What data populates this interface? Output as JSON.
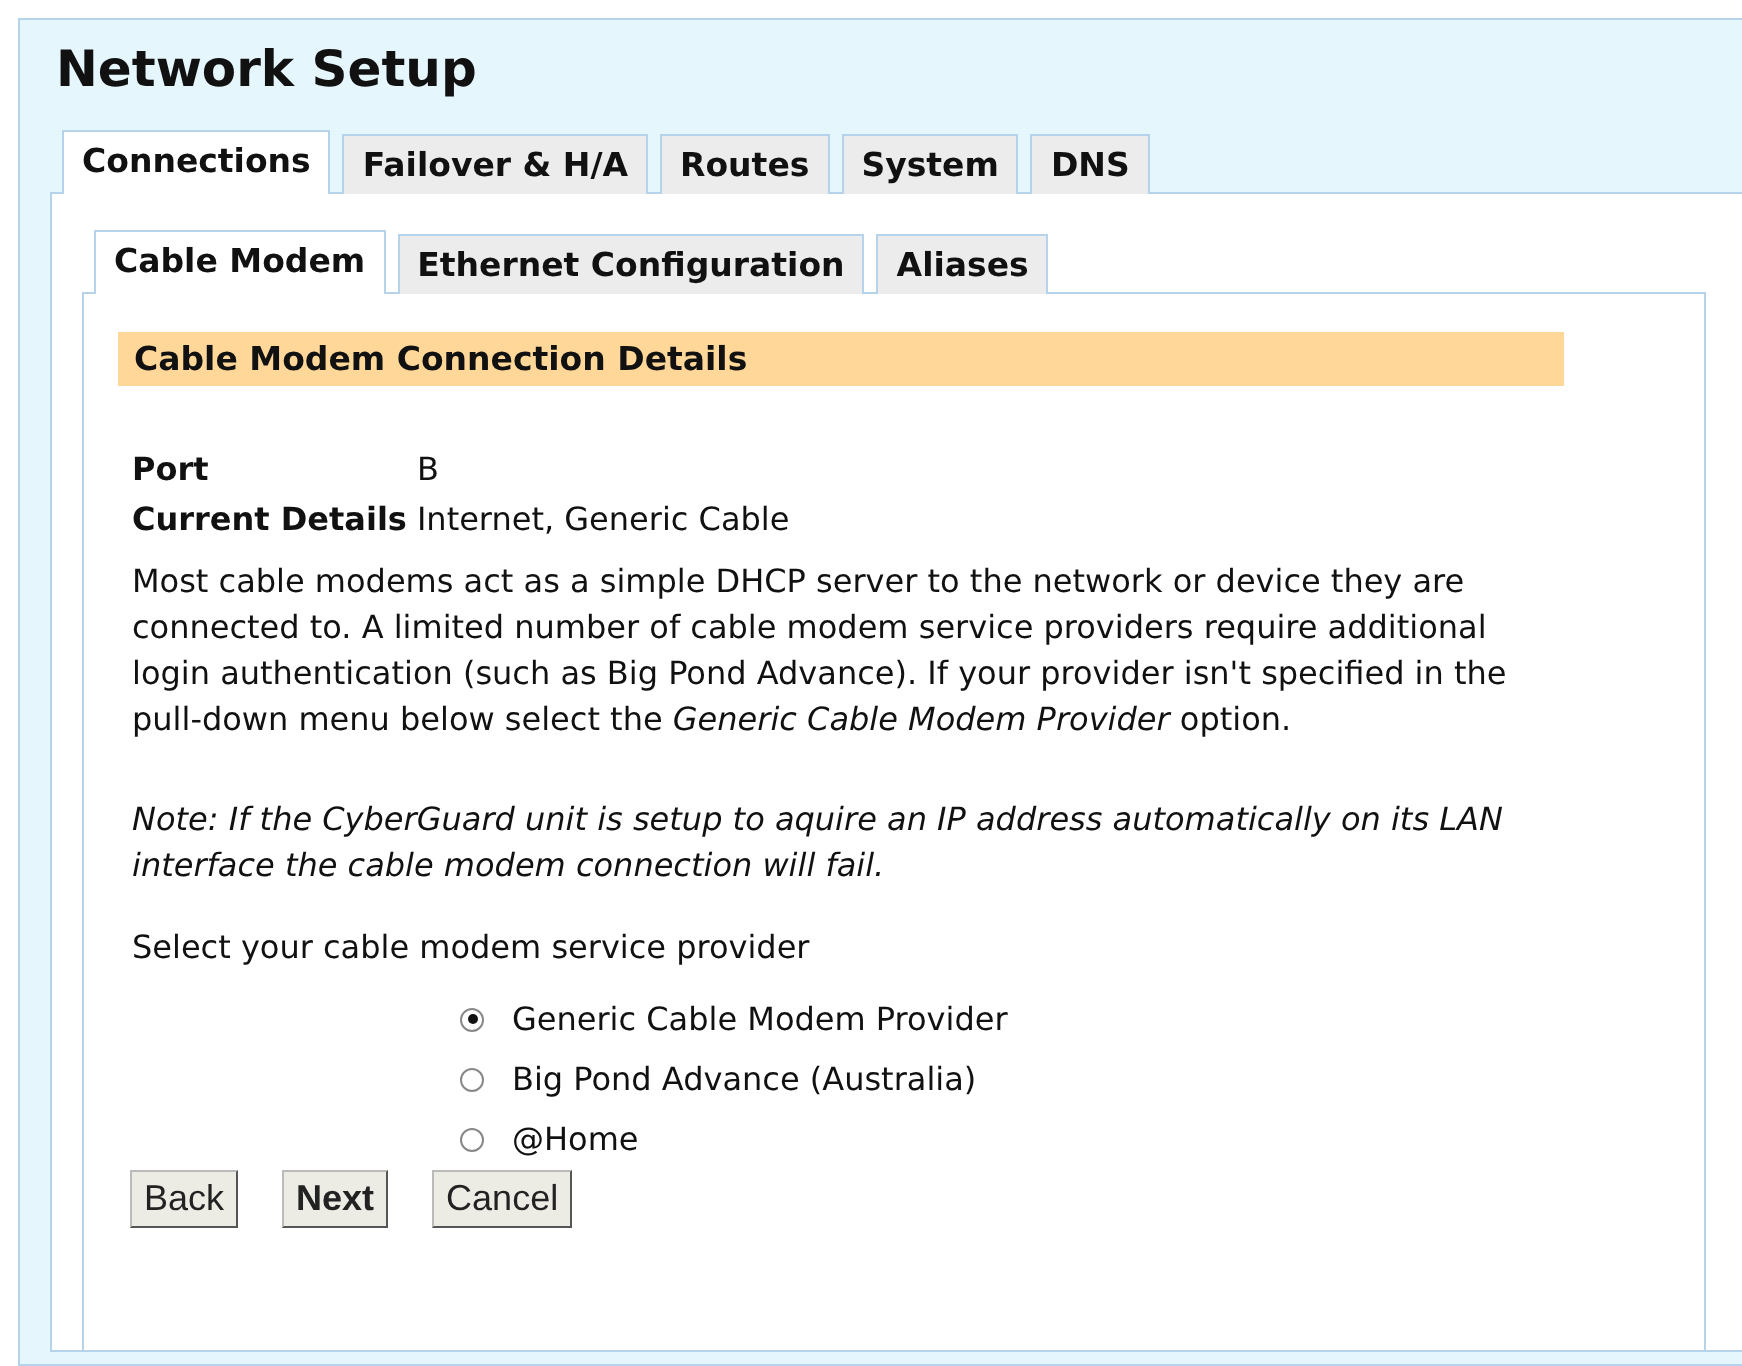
{
  "page": {
    "title": "Network Setup"
  },
  "tabs": [
    {
      "label": "Connections",
      "selected": true
    },
    {
      "label": "Failover & H/A",
      "selected": false
    },
    {
      "label": "Routes",
      "selected": false
    },
    {
      "label": "System",
      "selected": false
    },
    {
      "label": "DNS",
      "selected": false
    }
  ],
  "subtabs": [
    {
      "label": "Cable Modem",
      "selected": true
    },
    {
      "label": "Ethernet Configuration",
      "selected": false
    },
    {
      "label": "Aliases",
      "selected": false
    }
  ],
  "section": {
    "heading": "Cable Modem Connection Details",
    "details": [
      {
        "label": "Port",
        "value": "B"
      },
      {
        "label": "Current Details",
        "value": "Internet, Generic Cable"
      }
    ],
    "description": "Most cable modems act as a simple DHCP server to the network or device they are connected to. A limited number of cable modem service providers require additional login authentication (such as Big Pond Advance). If your provider isn't specified in the pull-down menu below select the *Generic Cable Modem Provider* option.",
    "note": "Note: If the CyberGuard unit is setup to aquire an IP address automatically on its LAN interface the cable modem connection will fail.",
    "prompt": "Select your cable modem service provider",
    "providers": [
      {
        "label": "Generic Cable Modem Provider",
        "selected": true
      },
      {
        "label": "Big Pond Advance (Australia)",
        "selected": false
      },
      {
        "label": "@Home",
        "selected": false
      }
    ]
  },
  "buttons": [
    {
      "label": "Back",
      "default": false
    },
    {
      "label": "Next",
      "default": true
    },
    {
      "label": "Cancel",
      "default": false
    }
  ]
}
